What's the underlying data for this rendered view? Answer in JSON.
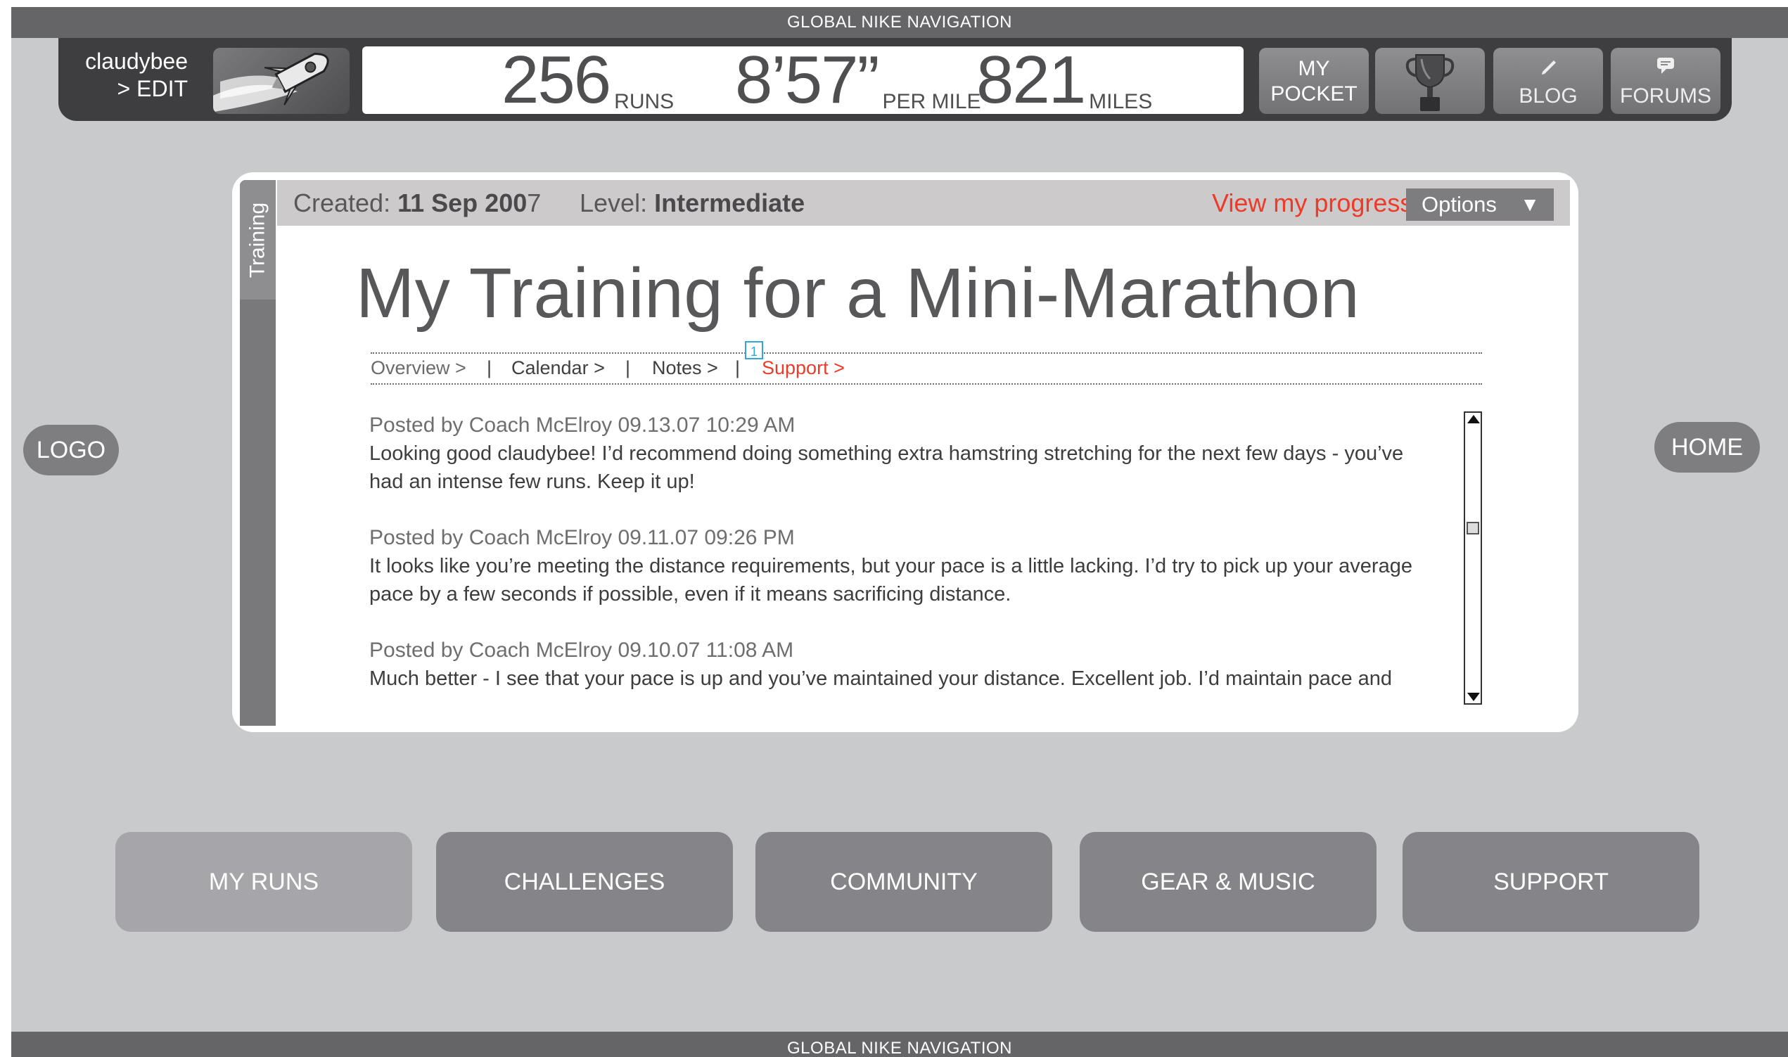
{
  "global_nav": {
    "top_label": "GLOBAL NIKE NAVIGATION",
    "bottom_label": "GLOBAL NIKE NAVIGATION"
  },
  "user": {
    "name": "claudybee",
    "edit_label": "> EDIT"
  },
  "stats": [
    {
      "value": "256",
      "unit": "RUNS"
    },
    {
      "value": "8’57”",
      "unit": "PER MILE"
    },
    {
      "value": "821",
      "unit": "MILES"
    }
  ],
  "top_tiles": {
    "pocket_line1": "MY",
    "pocket_line2": "POCKET",
    "blog": "BLOG",
    "forums": "FORUMS"
  },
  "side": {
    "logo": "LOGO",
    "home": "HOME"
  },
  "card": {
    "tab_label": "Training",
    "created_label": "Created:",
    "created_value_bold": "11 Sep 200",
    "created_value_tail": "7",
    "level_label": "Level:",
    "level_value": "Intermediate",
    "progress_link": "View my progress >",
    "options_label": "Options",
    "options_arrow": "▼",
    "title": "My Training for a Mini-Marathon",
    "subnav": {
      "overview": "Overview >",
      "calendar": "Calendar >",
      "notes": "Notes >",
      "support": "Support >",
      "separator": "|",
      "badge": "1"
    },
    "posts": [
      {
        "meta": "Posted by Coach McElroy 09.13.07 10:29 AM",
        "line1": "Looking good claudybee! I’d recommend doing something extra hamstring stretching for the next few days - you’ve",
        "line2": "had an intense few runs. Keep it up!"
      },
      {
        "meta": "Posted by Coach McElroy 09.11.07 09:26 PM",
        "line1": "It looks like you’re meeting the distance requirements, but your pace is a little lacking. I’d try to pick up your average",
        "line2": "pace by a few seconds if possible, even if it means sacrificing distance."
      },
      {
        "meta": "Posted by Coach McElroy 09.10.07 11:08 AM",
        "line1": "Much better - I see that your pace is up and you’ve maintained your distance. Excellent job. I’d maintain pace and",
        "line2": ""
      }
    ]
  },
  "bottom_nav": [
    "MY RUNS",
    "CHALLENGES",
    "COMMUNITY",
    "GEAR & MUSIC",
    "SUPPORT"
  ],
  "colors": {
    "accent": "#ec3b28",
    "badge": "#2fa7d9",
    "background": "#c9cacc",
    "bar": "#3e3e40"
  }
}
